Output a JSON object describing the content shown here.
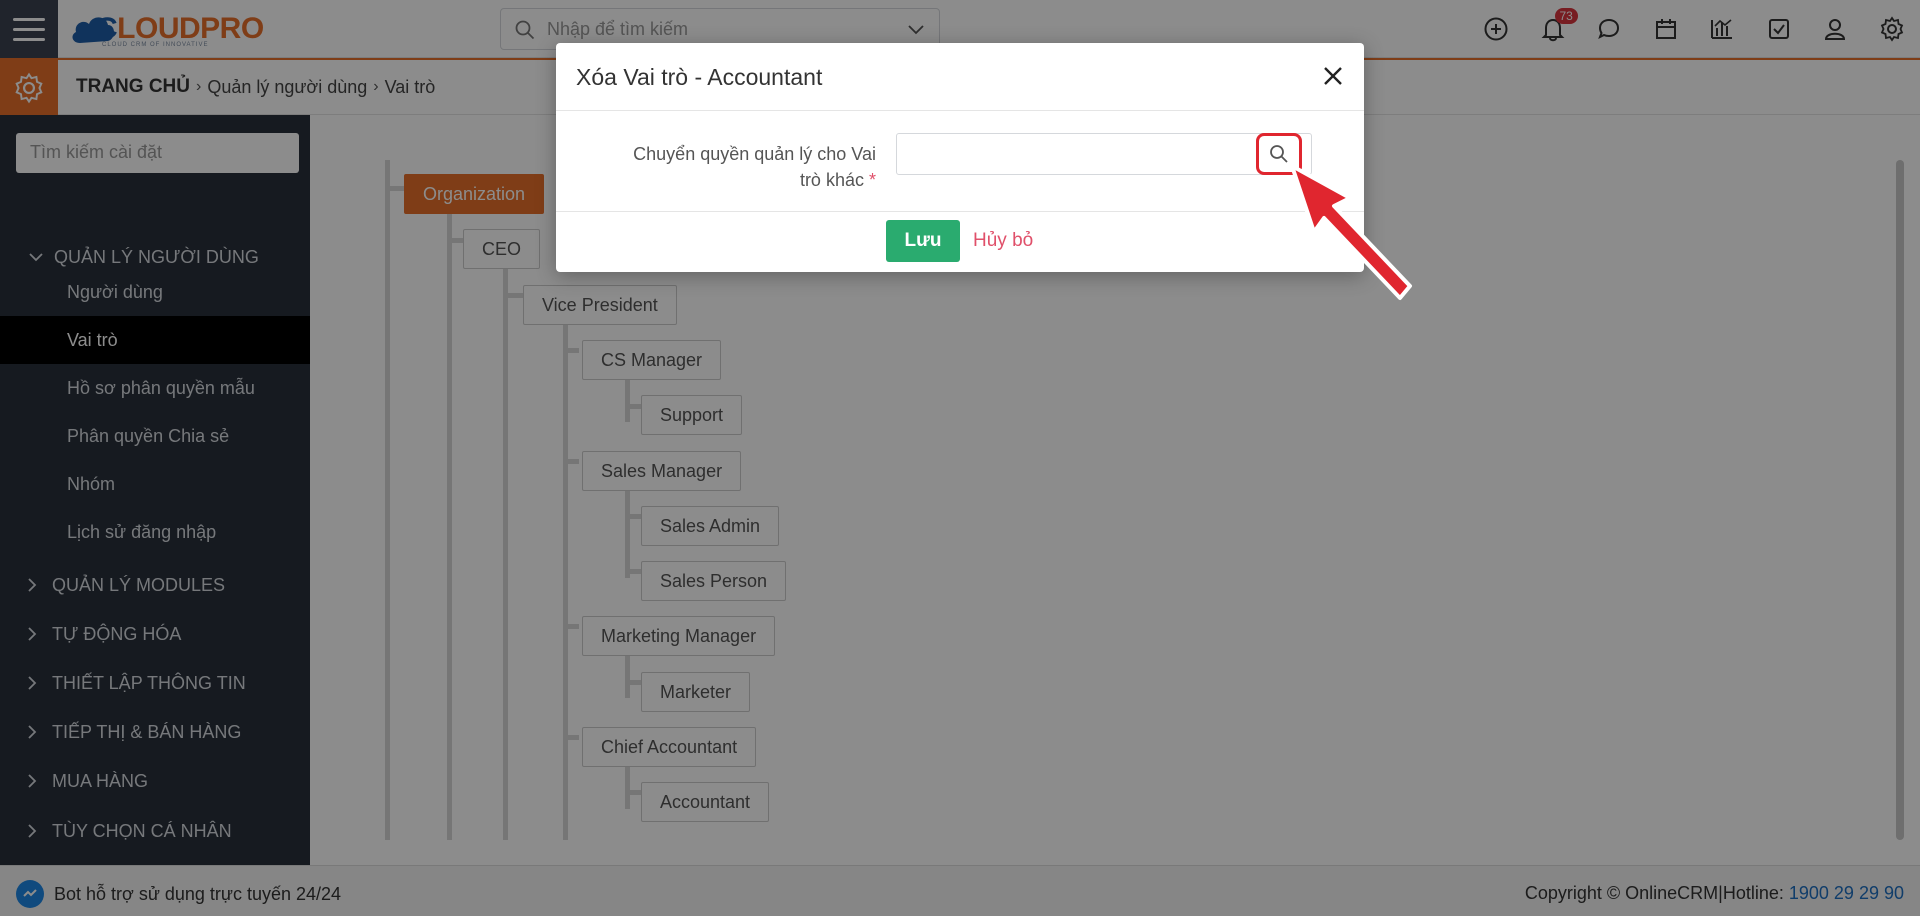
{
  "header": {
    "logo_a": "C",
    "logo_b": "LOUDPRO",
    "logo_sub": "CLOUD CRM OF INNOVATIVE",
    "search_placeholder": "Nhập để tìm kiếm",
    "notification_count": "73"
  },
  "breadcrumb": {
    "home": "TRANG CHỦ",
    "level1": "Quản lý người dùng",
    "level2": "Vai trò"
  },
  "sidebar": {
    "search_placeholder": "Tìm kiếm cài đặt",
    "group_users": "QUẢN LÝ NGƯỜI DÙNG",
    "items": [
      "Người dùng",
      "Vai trò",
      "Hồ sơ phân quyền mẫu",
      "Phân quyền Chia sẻ",
      "Nhóm",
      "Lịch sử đăng nhập"
    ],
    "active_item": "Vai trò",
    "groups": [
      "QUẢN LÝ MODULES",
      "TỰ ĐỘNG HÓA",
      "THIẾT LẬP THÔNG TIN",
      "TIẾP THỊ & BÁN HÀNG",
      "MUA HÀNG",
      "TÙY CHỌN CÁ NHÂN"
    ]
  },
  "roles_tree": {
    "organization": "Organization",
    "ceo": "CEO",
    "vice_president": "Vice President",
    "cs_manager": "CS Manager",
    "support": "Support",
    "sales_manager": "Sales Manager",
    "sales_admin": "Sales Admin",
    "sales_person": "Sales Person",
    "marketing_manager": "Marketing Manager",
    "marketer": "Marketer",
    "chief_accountant": "Chief Accountant",
    "accountant": "Accountant"
  },
  "modal": {
    "title": "Xóa Vai trò - Accountant",
    "field_label_line1": "Chuyển quyền quản lý cho Vai",
    "field_label_line2": "trò khác",
    "required_mark": "*",
    "field_value": "",
    "save_label": "Lưu",
    "cancel_label": "Hủy bỏ"
  },
  "footer": {
    "bot_text": "Bot hỗ trợ sử dụng trực tuyến 24/24",
    "copyright": "Copyright © OnlineCRM|Hotline: ",
    "hotline": "1900 29 29 90"
  },
  "colors": {
    "brand_orange": "#e8702a",
    "brand_blue": "#1e5ea8",
    "sidebar_bg": "#28303b",
    "save_green": "#2aab6f",
    "highlight_red": "#e0262f"
  }
}
